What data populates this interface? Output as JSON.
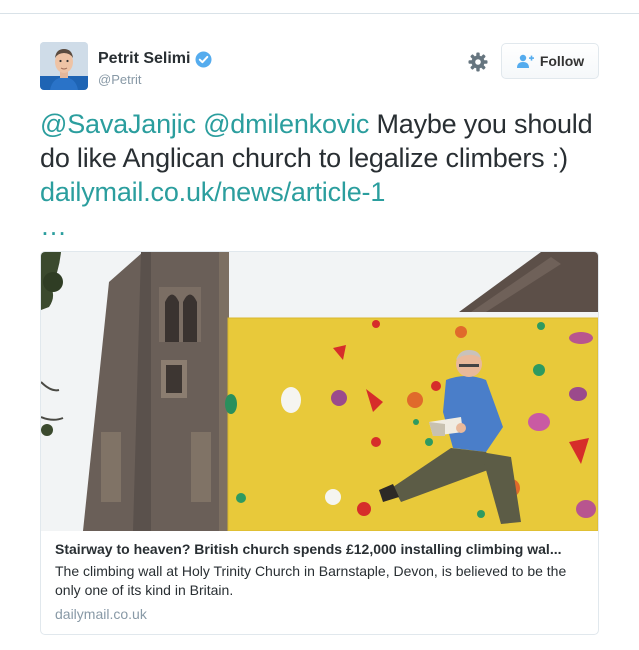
{
  "tweet": {
    "author_name": "Petrit Selimi",
    "author_handle": "@Petrit",
    "follow_label": "Follow",
    "text_parts": [
      {
        "kind": "mention",
        "text": "@SavaJanjic"
      },
      {
        "kind": "plain",
        "text": " "
      },
      {
        "kind": "mention",
        "text": "@dmilenkovic"
      },
      {
        "kind": "plain",
        "text": " Maybe you should do like Anglican church to legalize climbers :) "
      },
      {
        "kind": "link",
        "text": "dailymail.co.uk/news/article-1"
      },
      {
        "kind": "link",
        "text": " …"
      }
    ]
  },
  "card": {
    "title": "Stairway to heaven? British church spends £12,000 installing climbing wal...",
    "description": "The climbing wall at Holy Trinity Church in Barnstaple, Devon, is believed to be the only one of its kind in Britain.",
    "domain": "dailymail.co.uk"
  },
  "colors": {
    "link": "#2b9e9e",
    "verified": "#55acee",
    "wall": "#e8c93a"
  },
  "icons": {
    "verified": "verified-badge-icon",
    "settings": "gear-icon",
    "follow": "add-user-icon"
  }
}
